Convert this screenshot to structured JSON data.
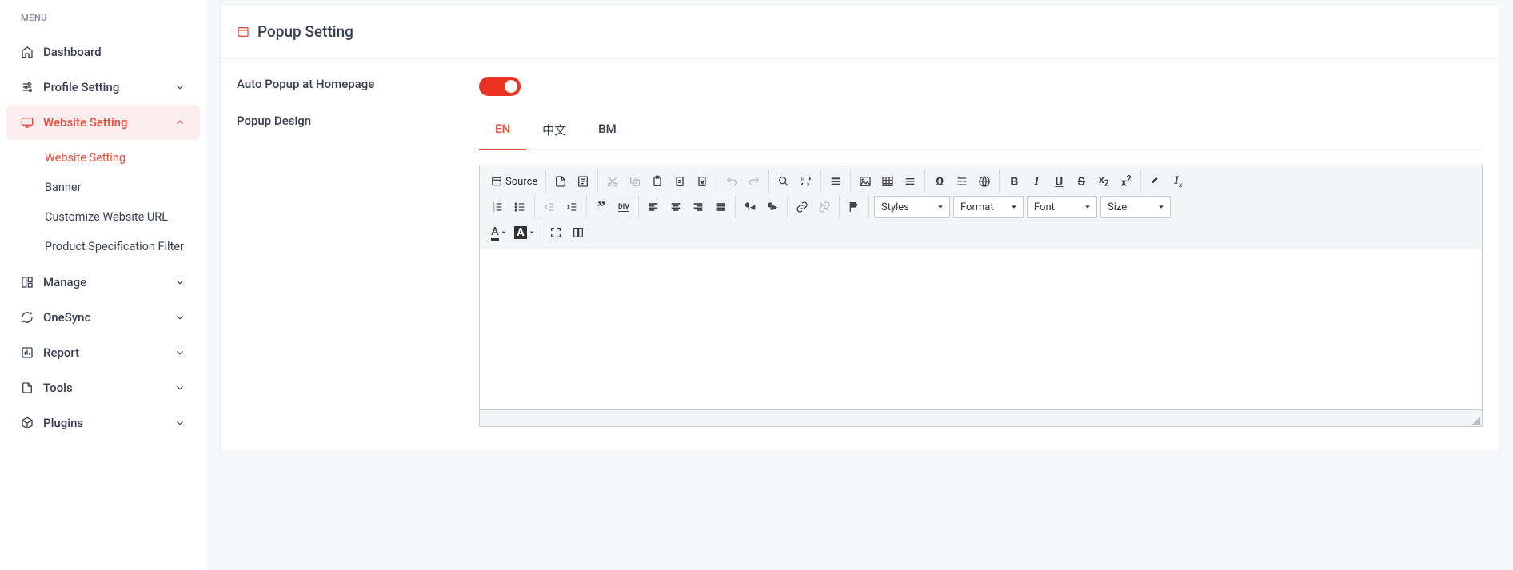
{
  "sidebar": {
    "menu_label": "MENU",
    "items": [
      {
        "label": "Dashboard"
      },
      {
        "label": "Profile Setting"
      },
      {
        "label": "Website Setting",
        "active": true,
        "children": [
          {
            "label": "Website Setting",
            "active": true
          },
          {
            "label": "Banner"
          },
          {
            "label": "Customize Website URL"
          },
          {
            "label": "Product Specification Filter"
          }
        ]
      },
      {
        "label": "Manage"
      },
      {
        "label": "OneSync"
      },
      {
        "label": "Report"
      },
      {
        "label": "Tools"
      },
      {
        "label": "Plugins"
      }
    ]
  },
  "page": {
    "title": "Popup Setting",
    "auto_popup_label": "Auto Popup at Homepage",
    "popup_design_label": "Popup Design",
    "toggle_on": true
  },
  "tabs": [
    "EN",
    "中文",
    "BM"
  ],
  "tab_active": "EN",
  "editor": {
    "source_label": "Source",
    "dropdowns": {
      "styles": "Styles",
      "format": "Format",
      "font": "Font",
      "size": "Size"
    }
  },
  "colors": {
    "accent": "#e74c3c"
  }
}
